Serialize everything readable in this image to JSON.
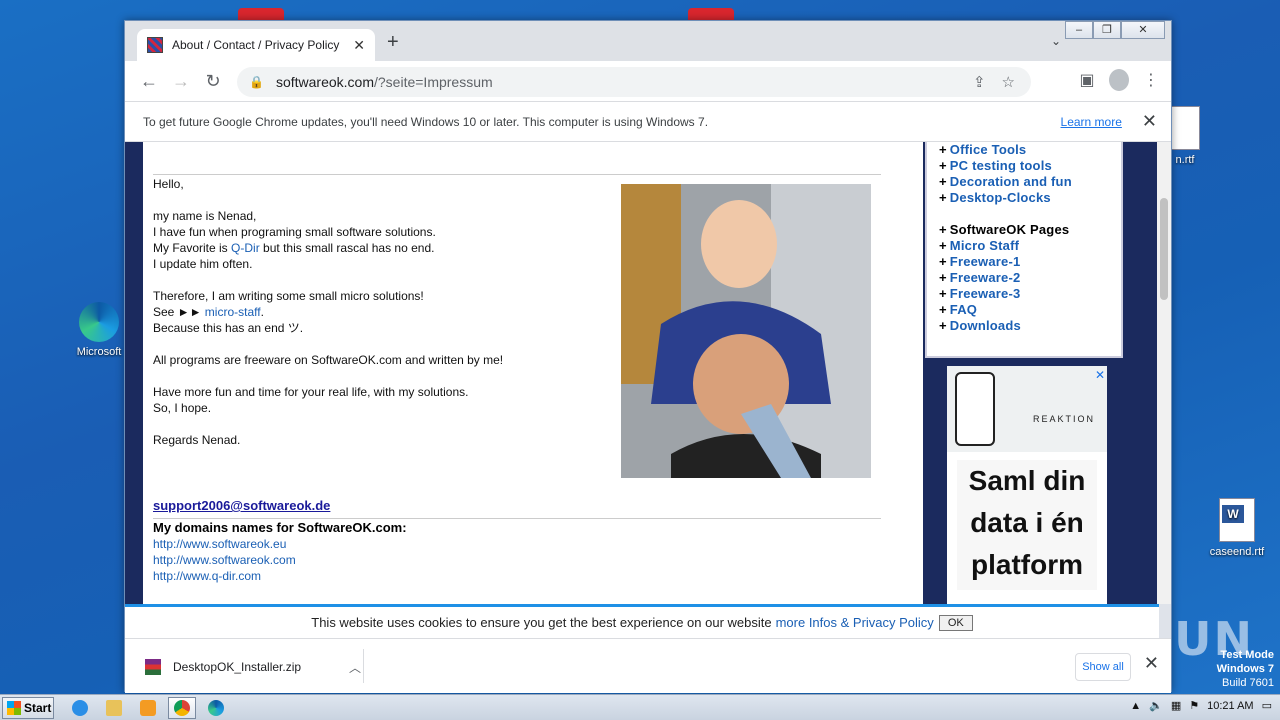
{
  "desktop": {
    "icons": [
      {
        "label": "Microsoft"
      },
      {
        "label": "n.rtf"
      },
      {
        "label": "caseend.rtf"
      }
    ],
    "watermark": "ANY RUN",
    "test_mode": {
      "line1": "Test Mode",
      "line2": "Windows 7",
      "line3": "Build 7601"
    }
  },
  "browser": {
    "tab": {
      "title": "About / Contact / Privacy Policy",
      "close": "✕"
    },
    "new_tab": "+",
    "tab_dropdown": "⌄",
    "window_controls": {
      "minimize": "‒",
      "restore": "❐",
      "close": "✕"
    },
    "url": {
      "host": "softwareok.com",
      "path": "/?seite=Impressum"
    },
    "infobar": {
      "message": "To get future Google Chrome updates, you'll need Windows 10 or later. This computer is using Windows 7.",
      "link": "Learn more",
      "close": "✕"
    }
  },
  "page": {
    "paragraphs": [
      "Hello,",
      "my name is Nenad,",
      "I have fun when programing small software solutions.",
      "My Favorite is",
      "Q-Dir",
      "but this small rascal has no end.",
      "I update him often.",
      "Therefore, I am writing some small micro solutions!",
      "See ►► ",
      "micro-staff",
      "Because this has an end ツ.",
      "All programs are freeware on SoftwareOK.com and written by me!",
      "Have more fun and time for your real life, with my solutions.",
      "So, I hope.",
      "Regards Nenad."
    ],
    "email": "support2006@softwareok.de",
    "domains_heading": "My domains names for SoftwareOK.com:",
    "domains": [
      "http://www.softwareok.eu",
      "http://www.softwareok.com",
      "http://www.q-dir.com"
    ]
  },
  "sidebar": {
    "items": [
      "Office Tools",
      "PC testing tools",
      "Decoration and fun",
      "Desktop-Clocks"
    ],
    "header": "SoftwareOK Pages",
    "pages": [
      "Micro Staff",
      "Freeware-1",
      "Freeware-2",
      "Freeware-3",
      "FAQ",
      "Downloads"
    ],
    "bullet": "+"
  },
  "ad": {
    "brand": "REAKTION",
    "text": "Saml din data i én platform",
    "close": "✕"
  },
  "cookie": {
    "message": "This website uses cookies to ensure you get the best experience on our website",
    "link": "more Infos & Privacy Policy",
    "ok": "OK"
  },
  "downloads": {
    "file": "DesktopOK_Installer.zip",
    "show_all": "Show all",
    "close": "✕"
  },
  "taskbar": {
    "start": "Start",
    "time": "10:21 AM"
  }
}
